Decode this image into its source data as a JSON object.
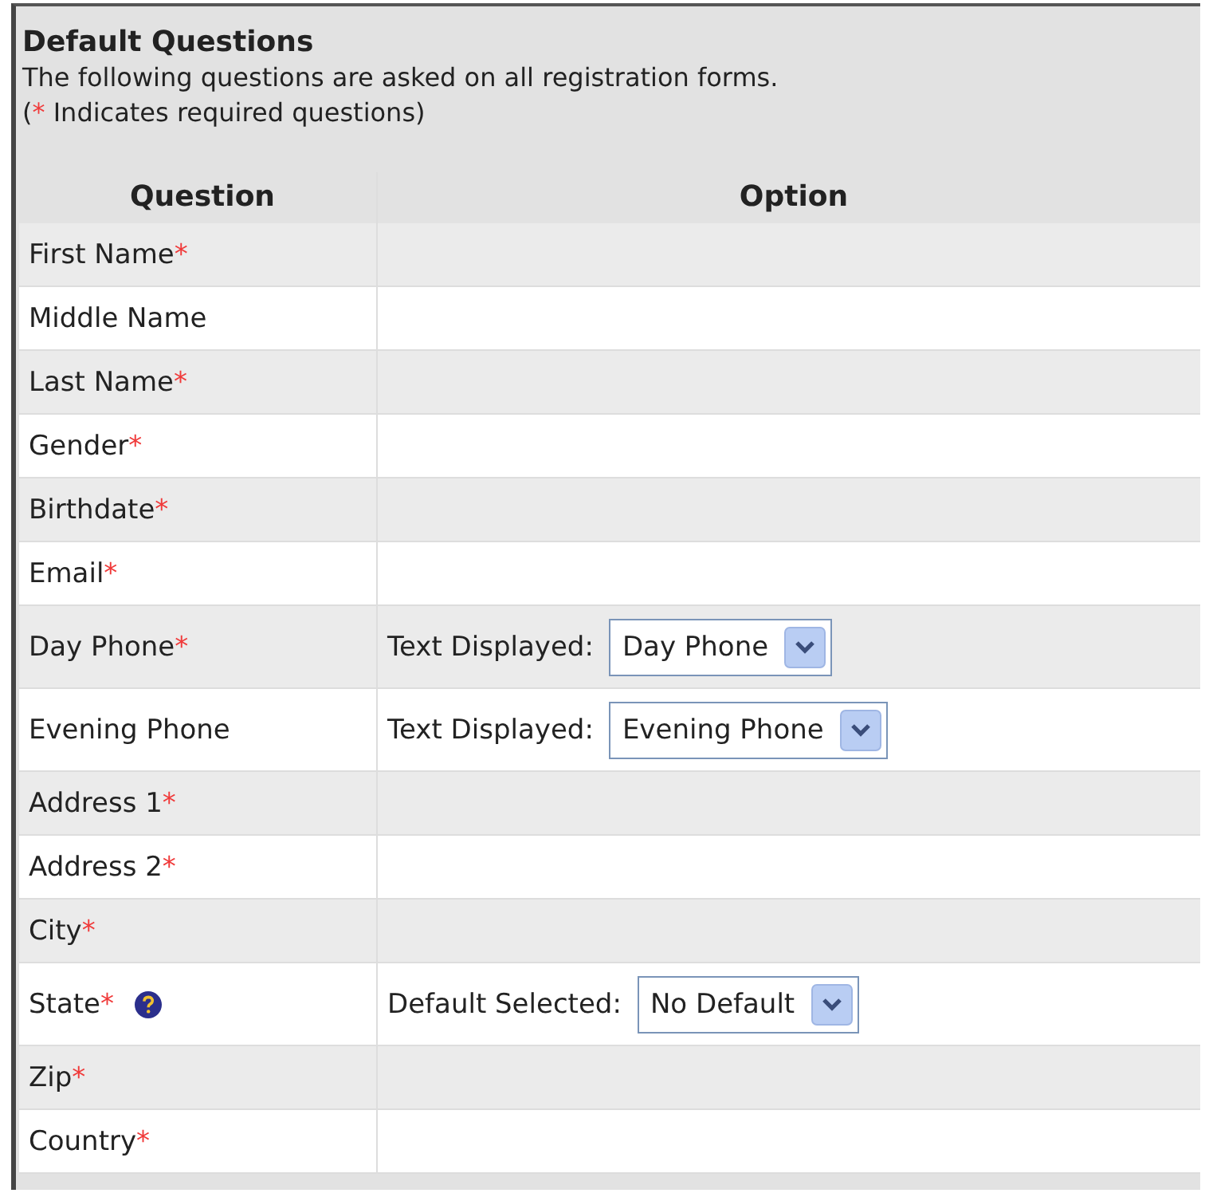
{
  "section": {
    "title": "Default Questions",
    "description": "The following questions are asked on all registration forms.",
    "legend_open": "(",
    "required_mark": "*",
    "legend_text": " Indicates required questions)"
  },
  "table": {
    "columns": [
      "Question",
      "Option"
    ],
    "rows": [
      {
        "label": "First Name",
        "required": true
      },
      {
        "label": "Middle Name",
        "required": false
      },
      {
        "label": "Last Name",
        "required": true
      },
      {
        "label": "Gender",
        "required": true
      },
      {
        "label": "Birthdate",
        "required": true
      },
      {
        "label": "Email",
        "required": true
      },
      {
        "label": "Day Phone",
        "required": true,
        "option": {
          "label": "Text Displayed:",
          "value": "Day Phone"
        }
      },
      {
        "label": "Evening Phone",
        "required": false,
        "option": {
          "label": "Text Displayed:",
          "value": "Evening Phone"
        }
      },
      {
        "label": "Address 1",
        "required": true
      },
      {
        "label": "Address 2",
        "required": true
      },
      {
        "label": "City",
        "required": true
      },
      {
        "label": "State",
        "required": true,
        "help": true,
        "option": {
          "label": "Default Selected:",
          "value": "No Default"
        }
      },
      {
        "label": "Zip",
        "required": true
      },
      {
        "label": "Country",
        "required": true
      }
    ]
  }
}
